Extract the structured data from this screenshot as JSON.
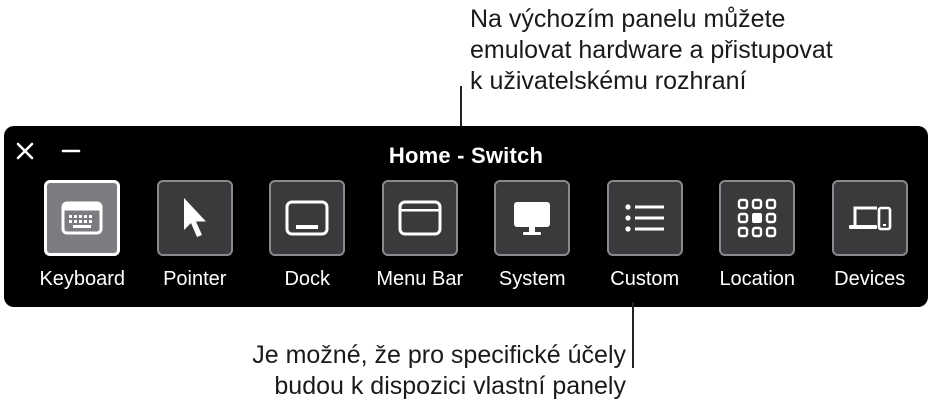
{
  "callouts": {
    "top": [
      "Na výchozím panelu můžete",
      "emulovat hardware a přistupovat",
      "k uživatelskému rozhraní"
    ],
    "bottom": [
      "Je možné, že pro specifické účely",
      "budou k dispozici vlastní panely"
    ]
  },
  "panel": {
    "title": "Home - Switch",
    "controls": {
      "close_icon": "close-icon",
      "minimize_icon": "minimize-icon"
    },
    "items": [
      {
        "label": "Keyboard",
        "icon": "keyboard-icon",
        "selected": true
      },
      {
        "label": "Pointer",
        "icon": "pointer-icon",
        "selected": false
      },
      {
        "label": "Dock",
        "icon": "dock-icon",
        "selected": false
      },
      {
        "label": "Menu Bar",
        "icon": "menu-bar-icon",
        "selected": false
      },
      {
        "label": "System",
        "icon": "system-icon",
        "selected": false
      },
      {
        "label": "Custom",
        "icon": "list-icon",
        "selected": false
      },
      {
        "label": "Location",
        "icon": "grid-icon",
        "selected": false
      },
      {
        "label": "Devices",
        "icon": "devices-icon",
        "selected": false
      }
    ]
  },
  "colors": {
    "panel_bg": "#000000",
    "tile_bg": "#3a3a3c",
    "tile_selected_bg": "#7c7c80",
    "text": "#ffffff"
  }
}
